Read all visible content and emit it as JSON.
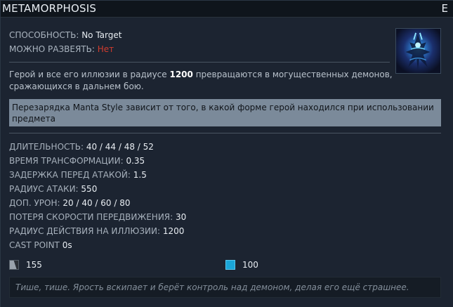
{
  "ability": {
    "name": "METAMORPHOSIS",
    "hotkey": "E",
    "hero_icon": "terrorblade-metamorphosis-icon"
  },
  "meta": {
    "ability_label": "СПОСОБНОСТЬ:",
    "ability_value": "No Target",
    "dispel_label": "МОЖНО РАЗВЕЯТЬ:",
    "dispel_value": "Нет",
    "dispel_color": "#d23c2e"
  },
  "description": {
    "part1": "Герой и все его иллюзии в радиусе ",
    "radius": "1200",
    "part2": " превращаются в могущественных демонов, сражающихся в дальнем бою."
  },
  "note": "Перезарядка Manta Style зависит от того, в какой форме герой находился при использовании предмета",
  "attributes": [
    {
      "label": "ДЛИТЕЛЬНОСТЬ:",
      "value": "40 / 44 / 48 / 52"
    },
    {
      "label": "ВРЕМЯ ТРАНСФОРМАЦИИ:",
      "value": "0.35"
    },
    {
      "label": "ЗАДЕРЖКА ПЕРЕД АТАКОЙ:",
      "value": "1.5"
    },
    {
      "label": "РАДИУС АТАКИ:",
      "value": "550"
    },
    {
      "label": "ДОП. УРОН:",
      "value": "20 / 40 / 60 / 80"
    },
    {
      "label": "ПОТЕРЯ СКОРОСТИ ПЕРЕДВИЖЕНИЯ:",
      "value": "30"
    },
    {
      "label": "РАДИУС ДЕЙСТВИЯ НА ИЛЛЮЗИИ:",
      "value": "1200"
    },
    {
      "label": "CAST POINT",
      "value": "0s"
    }
  ],
  "costs": {
    "cooldown": "155",
    "cooldown_icon": "cooldown-icon",
    "mana": "100",
    "mana_icon": "mana-icon",
    "mana_color": "#1aa6d8"
  },
  "lore": "Тише, тише. Ярость вскипает и берёт контроль над демоном, делая его ещё страшнее."
}
